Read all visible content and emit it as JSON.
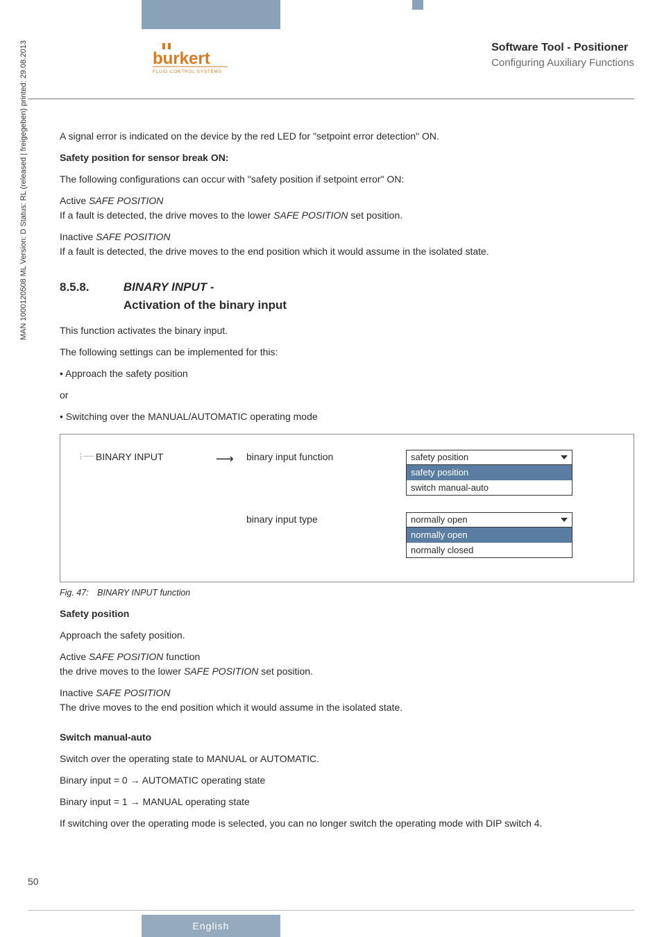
{
  "header": {
    "title_line1": "Software Tool - Positioner",
    "title_line2": "Configuring Auxiliary Functions",
    "logo_text": "burkert",
    "logo_sub": "FLUID CONTROL SYSTEMS"
  },
  "sidebar": {
    "text": "MAN 1000120508 ML Version: D Status: RL (released | freigegeben) printed: 29.08.2013"
  },
  "body": {
    "p1": "A signal error is indicated on the device by the red LED for \"setpoint error detection\" ON.",
    "p2_bold": "Safety position for sensor break ON:",
    "p3": "The following configurations can occur with \"safety position if setpoint error\" ON:",
    "p4a": "Active ",
    "p4b": "SAFE POSITION",
    "p5a": "If a fault is detected, the drive moves to the lower ",
    "p5b": "SAFE POSITION",
    "p5c": " set position.",
    "p6a": "Inactive ",
    "p6b": "SAFE POSITION",
    "p7": "If a fault is detected, the drive moves to the end position which it would assume in the isolated state.",
    "section_num": "8.5.8.",
    "section_title_italic": "BINARY INPUT",
    "section_title_rest": " - ",
    "section_title_line2": "Activation of the binary input",
    "p8": "This function activates the binary input.",
    "p9": "The following settings can be implemented for this:",
    "bullet1": "• Approach the safety position",
    "or_text": "or",
    "bullet2": "• Switching over the MANUAL/AUTOMATIC operating mode",
    "figure": {
      "tree_label": "BINARY INPUT",
      "label1": "binary input function",
      "label2": "binary input type",
      "dropdown1_selected": "safety position",
      "dropdown1_opt1": "safety position",
      "dropdown1_opt2": "switch manual-auto",
      "dropdown2_selected": "normally open",
      "dropdown2_opt1": "normally open",
      "dropdown2_opt2": "normally closed"
    },
    "figure_caption": "Fig. 47: BINARY INPUT function",
    "sp_heading": "Safety position",
    "sp_p1": "Approach the safety position.",
    "sp_p2a": "Active ",
    "sp_p2b": "SAFE POSITION",
    "sp_p2c": " function",
    "sp_p3a": "the drive moves to the lower ",
    "sp_p3b": "SAFE POSITION",
    "sp_p3c": " set position.",
    "sp_p4a": "Inactive ",
    "sp_p4b": "SAFE POSITION",
    "sp_p5": "The drive moves to the end position which it would assume in the isolated state.",
    "sma_heading": "Switch manual-auto",
    "sma_p1": "Switch over the operating state to MANUAL or AUTOMATIC.",
    "sma_p2": "Binary input = 0 → AUTOMATIC operating state",
    "sma_p3": "Binary input = 1 → MANUAL operating state",
    "sma_p4": "If switching over the operating mode is selected, you can no longer switch the operating mode with DIP switch 4."
  },
  "footer": {
    "page": "50",
    "language": "English"
  }
}
